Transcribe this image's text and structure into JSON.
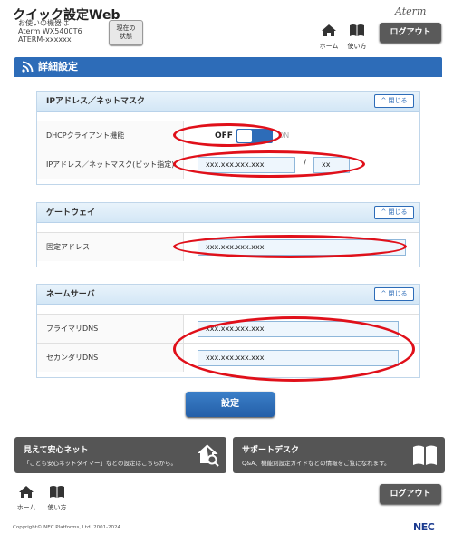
{
  "header": {
    "app_title": "クイック設定Web",
    "device_caption": "お使いの機器は",
    "device_model": "Aterm WX5400T6",
    "device_id": "ATERM-xxxxxx",
    "status_button_line1": "現在の",
    "status_button_line2": "状態",
    "brand": "Aterm",
    "nav_home": "ホーム",
    "nav_howto": "使い方",
    "logout": "ログアウト"
  },
  "page": {
    "title": "詳細設定"
  },
  "sections": {
    "ip": {
      "title": "IPアドレス／ネットマスク",
      "close_label": "閉じる",
      "dhcp_label": "DHCPクライアント機能",
      "toggle_off": "OFF",
      "toggle_on": "ON",
      "toggle_state": "OFF",
      "ip_label": "IPアドレス／ネットマスク(ビット指定)",
      "ip_value": "xxx.xxx.xxx.xxx",
      "separator": "/",
      "mask_value": "xx"
    },
    "gateway": {
      "title": "ゲートウェイ",
      "close_label": "閉じる",
      "fixed_label": "固定アドレス",
      "fixed_value": "xxx.xxx.xxx.xxx"
    },
    "dns": {
      "title": "ネームサーバ",
      "close_label": "閉じる",
      "primary_label": "プライマリDNS",
      "primary_value": "xxx.xxx.xxx.xxx",
      "secondary_label": "セカンダリDNS",
      "secondary_value": "xxx.xxx.xxx.xxx"
    }
  },
  "submit_label": "設定",
  "banners": {
    "safety_title": "見えて安心ネット",
    "safety_sub": "「こども安心ネットタイマー」などの設定はこちらから。",
    "support_title": "サポートデスク",
    "support_sub": "Q&A、機能別設定ガイドなどの情報をご覧になれます。"
  },
  "footer": {
    "nav_home": "ホーム",
    "nav_howto": "使い方",
    "logout": "ログアウト",
    "copyright": "Copyright© NEC Platforms, Ltd. 2001-2024",
    "logo": "NEC"
  },
  "colors": {
    "accent": "#2d6cb8",
    "annotation": "#e0101a",
    "dark_button": "#5a5a5a"
  },
  "icons": [
    "home-icon",
    "book-icon",
    "wifi-icon",
    "chevron-up-icon",
    "house-search-icon",
    "book-open-icon"
  ]
}
